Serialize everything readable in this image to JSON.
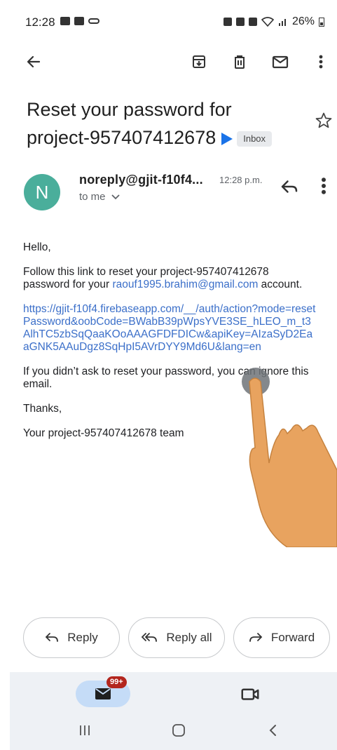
{
  "status_bar": {
    "time": "12:28",
    "battery": "26%"
  },
  "toolbar": {
    "icons": [
      "back-arrow-icon",
      "archive-icon",
      "delete-icon",
      "mark-unread-icon",
      "more-vert-icon"
    ]
  },
  "email": {
    "subject": "Reset your password for project-957407412678",
    "label": "Inbox",
    "sender_initial": "N",
    "sender": "noreply@gjit-f10f4...",
    "time": "12:28 p.m.",
    "recipient": "to me",
    "greeting": "Hello,",
    "intro": "Follow this link to reset your project-957407412678 password for your ",
    "account_email": "raouf1995.brahim@gmail.com",
    "intro_tail": " account.",
    "reset_link": "https://gjit-f10f4.firebaseapp.com/__/auth/action?mode=resetPassword&oobCode=BWabB39pWpsYVE3SE_hLEO_m_t3AlhTC5zbSqQaaKOoAAAGFDFDICw&apiKey=AIzaSyD2EaaGNK5AAuDgz8SqHpI5AVrDYY9Md6U&lang=en",
    "ignore_note": "If you didn’t ask to reset your password, you can ignore this email.",
    "thanks": "Thanks,",
    "signature": "Your project-957407412678 team"
  },
  "actions": {
    "reply": "Reply",
    "reply_all": "Reply all",
    "forward": "Forward"
  },
  "bottom_nav": {
    "mail_badge": "99+"
  },
  "colors": {
    "link": "#3b6fc9",
    "avatar": "#4aae9b",
    "badge": "#b3261e",
    "pill": "#c5dcf7",
    "nav_bg": "#eef1f5",
    "hand": "#e8a35f"
  }
}
